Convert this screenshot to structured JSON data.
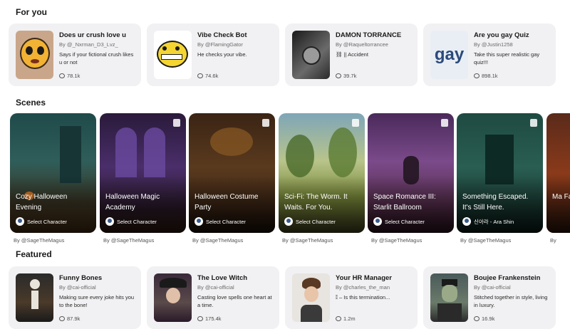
{
  "sections": {
    "for_you": "For you",
    "scenes": "Scenes",
    "featured": "Featured"
  },
  "for_you": [
    {
      "name": "Does ur crush love u",
      "author": "By @_Nxrman_D3_Lvz_",
      "desc": "Says if your fictional crush likes u or not",
      "stats": "78.1k"
    },
    {
      "name": "Vibe Check Bot",
      "author": "By @FlamingGator",
      "desc": "He checks your vibe.",
      "stats": "74.6k"
    },
    {
      "name": "DAMON TORRANCE",
      "author": "By @Raqueltorrancee",
      "desc": "⛓ || Accident",
      "stats": "39.7k"
    },
    {
      "name": "Are you gay Quiz",
      "author": "By @Justin1258",
      "desc": "Take this super realistic gay quiz!!!",
      "stats": "898.1k",
      "thumb_text": "gay"
    }
  ],
  "scenes": [
    {
      "title": "Cozy Halloween Evening",
      "select": "Select Character",
      "by": "By @SageTheMagus"
    },
    {
      "title": "Halloween Magic Academy",
      "select": "Select Character",
      "by": "By @SageTheMagus"
    },
    {
      "title": "Halloween Costume Party",
      "select": "Select Character",
      "by": "By @SageTheMagus"
    },
    {
      "title": "Sci-Fi: The Worm. It Waits. For You.",
      "select": "Select Character",
      "by": "By @SageTheMagus"
    },
    {
      "title": "Space Romance III: Starlit Ballroom",
      "select": "Select Character",
      "by": "By @SageTheMagus"
    },
    {
      "title": "Something Escaped. It's Still Here.",
      "select": "신아라 - Ara Shin",
      "by": "By @SageTheMagus"
    },
    {
      "title": "Ma Fa",
      "select": "",
      "by": "By"
    }
  ],
  "featured": [
    {
      "name": "Funny Bones",
      "author": "By @cai-official",
      "desc": "Making sure every joke hits you to the bone!",
      "stats": "87.9k"
    },
    {
      "name": "The Love Witch",
      "author": "By @cai-official",
      "desc": "Casting love spells one heart at a time.",
      "stats": "175.4k"
    },
    {
      "name": "Your HR Manager",
      "author": "By @charles_the_man",
      "desc": "𝕀 – Is this termination...",
      "stats": "1.2m"
    },
    {
      "name": "Boujee Frankenstein",
      "author": "By @cai-official",
      "desc": "Stitched together in style, living in luxury.",
      "stats": "16.9k"
    }
  ]
}
